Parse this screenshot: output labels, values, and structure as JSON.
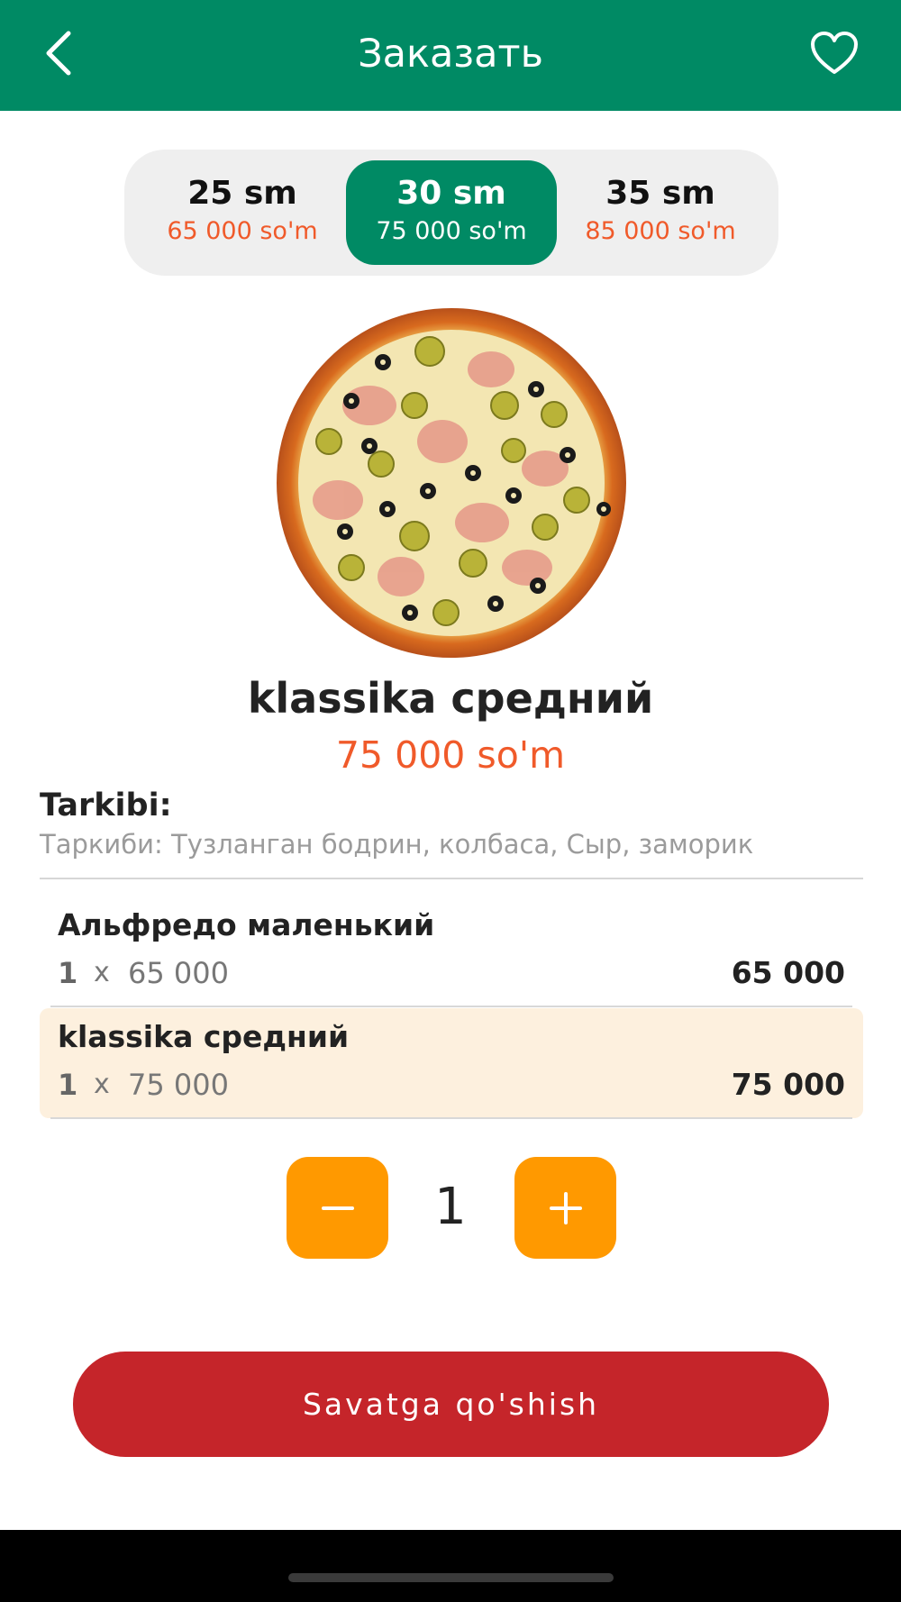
{
  "header": {
    "title": "Заказать",
    "back_icon": "chevron-left-icon",
    "favorite_icon": "heart-outline-icon",
    "bg_color": "#008a64"
  },
  "sizes": [
    {
      "label": "25 sm",
      "price": "65 000 so'm",
      "selected": false
    },
    {
      "label": "30 sm",
      "price": "75 000 so'm",
      "selected": true
    },
    {
      "label": "35 sm",
      "price": "85 000 so'm",
      "selected": false
    }
  ],
  "product": {
    "name": "klassika средний",
    "price": "75 000 so'm",
    "composition_label": "Tarkibi:",
    "composition_text": "Таркиби: Тузланган бодрин, колбаса, Сыр, заморик"
  },
  "cart": {
    "items": [
      {
        "name": "Альфредо маленький",
        "qty": "1",
        "multiplier": "x",
        "unit_price": "65 000",
        "total": "65 000",
        "highlighted": false
      },
      {
        "name": "klassika средний",
        "qty": "1",
        "multiplier": "x",
        "unit_price": "75 000",
        "total": "75 000",
        "highlighted": true
      }
    ]
  },
  "quantity": {
    "value": "1",
    "minus_icon": "minus-icon",
    "plus_icon": "plus-icon",
    "button_color": "#ff9900"
  },
  "actions": {
    "add_to_cart_label": "Savatga qo'shish",
    "add_to_cart_color": "#c5252a"
  },
  "colors": {
    "accent_price": "#f05a2a",
    "highlight_row": "#fdf0de"
  }
}
